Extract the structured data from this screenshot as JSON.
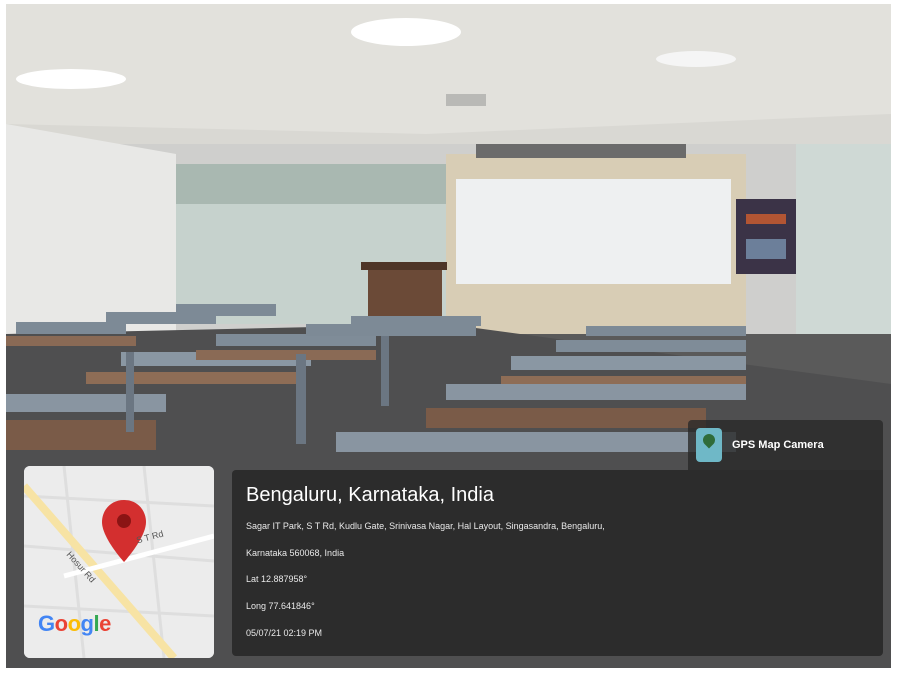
{
  "badge": {
    "label": "GPS Map Camera",
    "icon": "map-pin-icon"
  },
  "location": {
    "title": "Bengaluru, Karnataka, India",
    "address_line1": "Sagar IT Park, S T Rd, Kudlu Gate, Srinivasa Nagar, Hal Layout, Singasandra, Bengaluru,",
    "address_line2": "Karnataka 560068, India",
    "lat": "Lat 12.887958°",
    "long": "Long 77.641846°",
    "datetime": "05/07/21 02:19 PM"
  },
  "map": {
    "logo": "Google",
    "road_1": "Hosur Rd",
    "road_2": "S T Rd",
    "pin_color": "#d32f2f"
  },
  "colors": {
    "overlay": "#232323",
    "badge_icon": "#6fb8c7"
  }
}
